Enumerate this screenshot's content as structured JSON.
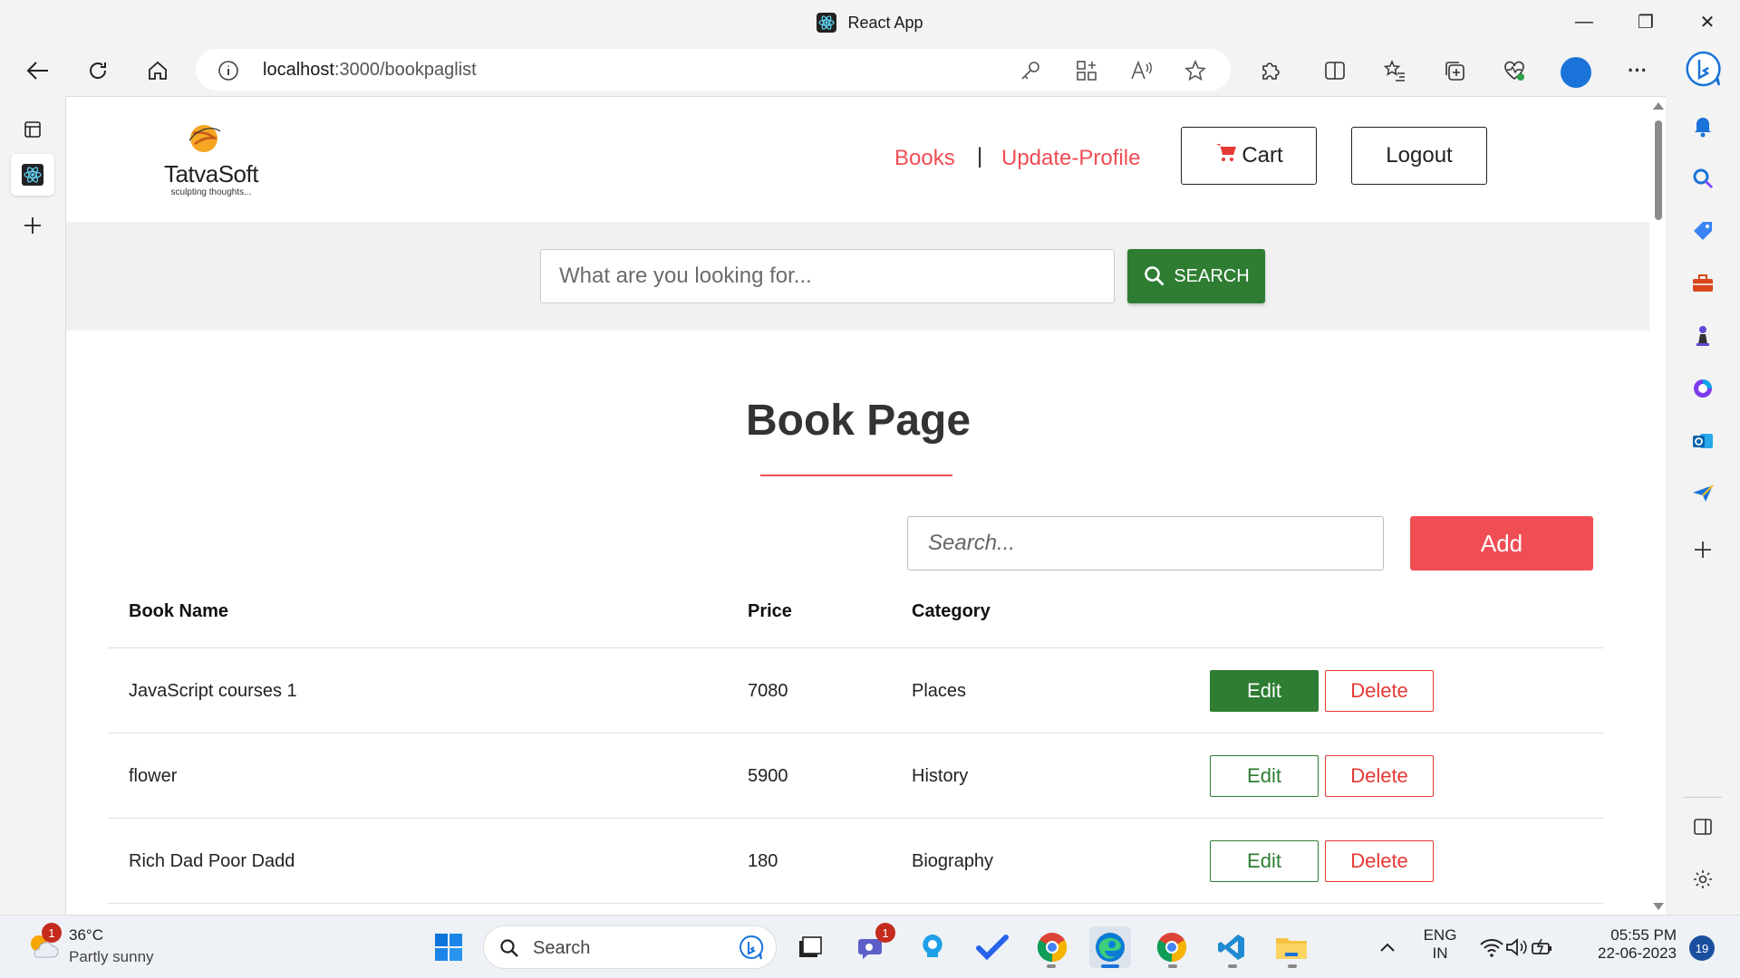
{
  "window": {
    "title": "React App",
    "minimize": "—",
    "maximize": "❐",
    "close": "✕"
  },
  "browser": {
    "url_host": "localhost",
    "url_path": ":3000/bookpaglist",
    "more": "···"
  },
  "site": {
    "logo_name": "TatvaSoft",
    "logo_tagline": "sculpting thoughts...",
    "nav_books": "Books",
    "nav_separator": "|",
    "nav_update_profile": "Update-Profile",
    "cart_label": "Cart",
    "logout_label": "Logout",
    "search_placeholder": "What are you looking for...",
    "search_button": "SEARCH",
    "accent_color": "#f14d54",
    "green_color": "#2e7d32"
  },
  "book_page": {
    "title": "Book Page",
    "search_placeholder": "Search...",
    "add_label": "Add",
    "columns": [
      "Book Name",
      "Price",
      "Category"
    ],
    "rows": [
      {
        "name": "JavaScript courses 1",
        "price": "7080",
        "category": "Places",
        "edit": "Edit",
        "delete": "Delete"
      },
      {
        "name": "flower",
        "price": "5900",
        "category": "History",
        "edit": "Edit",
        "delete": "Delete"
      },
      {
        "name": "Rich Dad Poor Dadd",
        "price": "180",
        "category": "Biography",
        "edit": "Edit",
        "delete": "Delete"
      }
    ]
  },
  "taskbar": {
    "weather_badge": "1",
    "temperature": "36°C",
    "weather": "Partly sunny",
    "search_label": "Search",
    "teams_badge": "1",
    "lang_line1": "ENG",
    "lang_line2": "IN",
    "time": "05:55 PM",
    "date": "22-06-2023",
    "notifications": "19"
  }
}
